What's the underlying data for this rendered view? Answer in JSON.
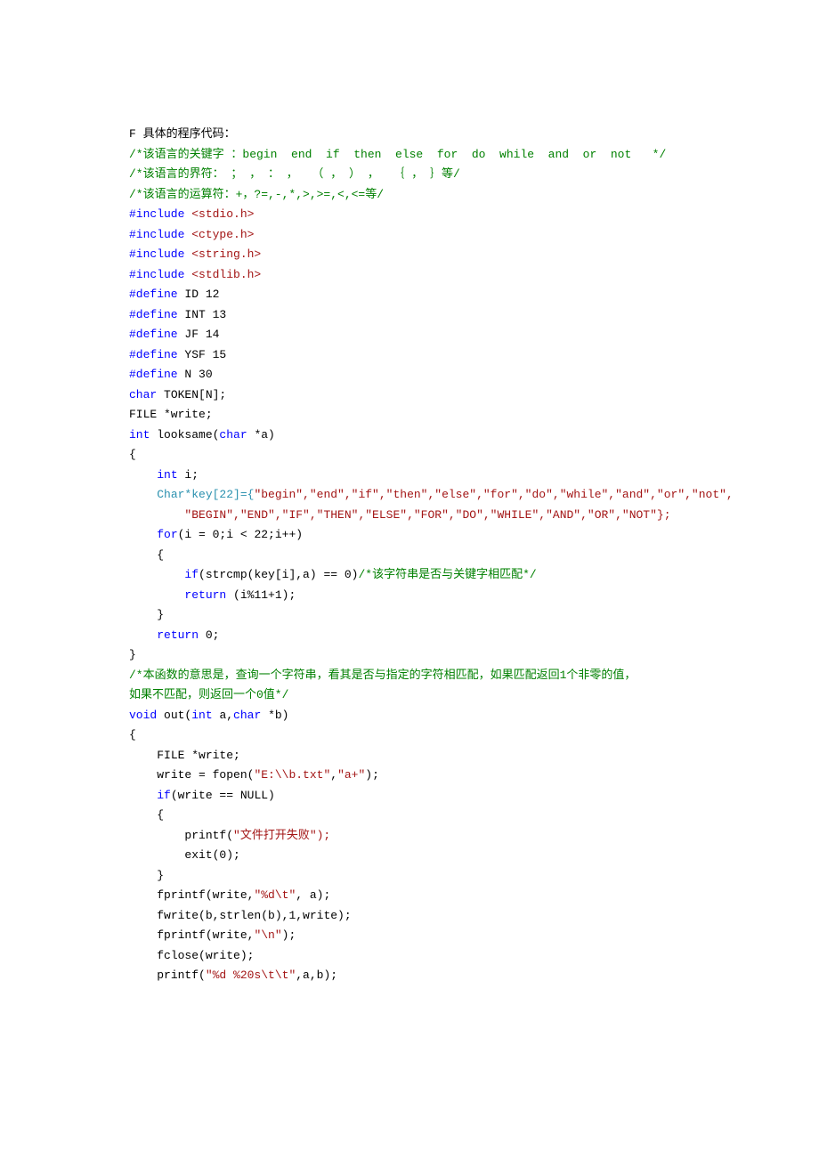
{
  "title": "F 具体的程序代码：",
  "comments": {
    "c1": "/*该语言的关键字 ：begin  end  if  then  else  for  do  while  and  or  not   */",
    "c2": "/*该语言的界符： ； ， ： ，  （ ， ） ，  ｛ ， ｝等/",
    "c3": "/*该语言的运算符：+，?=,-,*,>,>=,<,<=等/",
    "c4": "/*该字符串是否与关键字相匹配*/",
    "c5": "/*本函数的意思是，查询一个字符串，看其是否与指定的字符相匹配，如果匹配返回1个非零的值，",
    "c6": "如果不匹配，则返回一个0值*/"
  },
  "kw": {
    "include": "#include",
    "define": "#define",
    "char": "char",
    "int": "int",
    "for": "for",
    "if": "if",
    "return": "return",
    "void": "void"
  },
  "inc": {
    "stdio": " <stdio.h>",
    "ctype": " <ctype.h>",
    "string": " <string.h>",
    "stdlib": " <stdlib.h>"
  },
  "def": {
    "id": " ID 12",
    "int": " INT 13",
    "jf": " JF 14",
    "ysf": " YSF 15",
    "n": " N 30"
  },
  "decl": {
    "token": " TOKEN[N];",
    "file": "FILE *write;",
    "looksame": " looksame(",
    "chara": " *a)",
    "inti": " i;",
    "charkey": "Char*key[22]={",
    "forloop": "(i = 0;i < 22;i++)",
    "strcmp": "(strcmp(key[i],a) == 0)",
    "retmod": " (i%11+1);",
    "ret0": " 0;",
    "outfn": " out(",
    "outarg1": " a,",
    "outarg2": " *b)",
    "filewrite": "FILE *write;",
    "fopen1": "write = fopen(",
    "fopen2": ",",
    "fopen3": ");",
    "ifnull": "(write == NULL)",
    "printf": "printf(",
    "exit": "exit(0);",
    "fprintf1a": "fprintf(write,",
    "fprintf1b": ", a);",
    "fwrite": "fwrite(b,strlen(b),1,write);",
    "fprintf2a": "fprintf(write,",
    "fprintf2b": ");",
    "fclose": "fclose(write);",
    "printf2a": "printf(",
    "printf2b": ",a,b);"
  },
  "str": {
    "keys1": "\"begin\",\"end\",\"if\",\"then\",\"else\",\"for\",\"do\",\"while\",\"and\",\"or\",\"not\",",
    "keys2": "\"BEGIN\",\"END\",\"IF\",\"THEN\",\"ELSE\",\"FOR\",\"DO\",\"WHILE\",\"AND\",\"OR\",\"NOT\"};",
    "ebpath": "\"E:\\\\b.txt\"",
    "aplus": "\"a+\"",
    "openfail": "\"文件打开失败\");",
    "fmtdt": "\"%d\\t\"",
    "fmtnl": "\"\\n\"",
    "fmtlast": "\"%d %20s\\t\\t\""
  },
  "punc": {
    "obrace": "{",
    "cbrace": "}",
    "ind1": "    ",
    "ind2": "        ",
    "ind3": "            "
  }
}
